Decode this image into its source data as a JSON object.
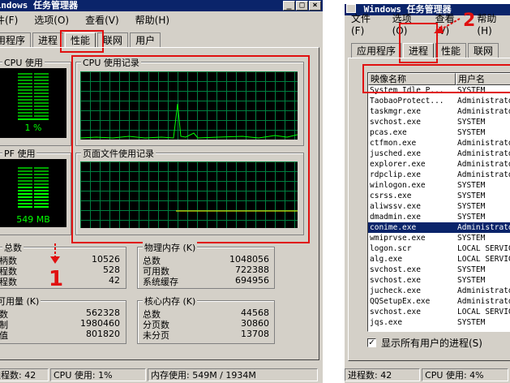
{
  "left": {
    "title": "Windows 任务管理器",
    "menu": [
      "文件(F)",
      "选项(O)",
      "查看(V)",
      "帮助(H)"
    ],
    "tabs": [
      "应用程序",
      "进程",
      "性能",
      "联网",
      "用户"
    ],
    "cpu_usage_label": "CPU 使用",
    "cpu_usage_value": "1 %",
    "cpu_history_label": "CPU 使用记录",
    "pf_usage_label": "PF 使用",
    "pf_usage_value": "549 MB",
    "pf_history_label": "页面文件使用记录",
    "totals": {
      "title": "总数",
      "rows": [
        {
          "label": "句柄数",
          "value": "10526"
        },
        {
          "label": "线程数",
          "value": "528"
        },
        {
          "label": "进程数",
          "value": "42"
        }
      ]
    },
    "physical_memory": {
      "title": "物理内存 (K)",
      "rows": [
        {
          "label": "总数",
          "value": "1048056"
        },
        {
          "label": "可用数",
          "value": "722388"
        },
        {
          "label": "系统缓存",
          "value": "694956"
        }
      ]
    },
    "commit_charge": {
      "title": "认可用量 (K)",
      "rows": [
        {
          "label": "总数",
          "value": "562328"
        },
        {
          "label": "限制",
          "value": "1980460"
        },
        {
          "label": "峰值",
          "value": "801820"
        }
      ]
    },
    "kernel_memory": {
      "title": "核心内存 (K)",
      "rows": [
        {
          "label": "总数",
          "value": "44568"
        },
        {
          "label": "分页数",
          "value": "30860"
        },
        {
          "label": "未分页",
          "value": "13708"
        }
      ]
    },
    "status": {
      "processes": "进程数: 42",
      "cpu": "CPU 使用: 1%",
      "memory": "内存使用: 549M / 1934M"
    },
    "annotation_number": "1"
  },
  "right": {
    "title": "Windows 任务管理器",
    "menu": [
      "文件(F)",
      "选项(O)",
      "查看(V)",
      "帮助(H)"
    ],
    "tabs": [
      "应用程序",
      "进程",
      "性能",
      "联网"
    ],
    "columns": [
      "映像名称",
      "用户名"
    ],
    "processes": [
      {
        "name": "System Idle P...",
        "user": "SYSTEM"
      },
      {
        "name": "TaobaoProtect...",
        "user": "Administrator"
      },
      {
        "name": "taskmgr.exe",
        "user": "Administrator"
      },
      {
        "name": "svchost.exe",
        "user": "SYSTEM"
      },
      {
        "name": "pcas.exe",
        "user": "SYSTEM"
      },
      {
        "name": "ctfmon.exe",
        "user": "Administrator"
      },
      {
        "name": "jusched.exe",
        "user": "Administrator"
      },
      {
        "name": "explorer.exe",
        "user": "Administrator"
      },
      {
        "name": "rdpclip.exe",
        "user": "Administrator"
      },
      {
        "name": "winlogon.exe",
        "user": "SYSTEM"
      },
      {
        "name": "csrss.exe",
        "user": "SYSTEM"
      },
      {
        "name": "aliwssv.exe",
        "user": "SYSTEM"
      },
      {
        "name": "dmadmin.exe",
        "user": "SYSTEM"
      },
      {
        "name": "conime.exe",
        "user": "Administrator"
      },
      {
        "name": "wmiprvse.exe",
        "user": "SYSTEM"
      },
      {
        "name": "logon.scr",
        "user": "LOCAL SERVICE"
      },
      {
        "name": "alg.exe",
        "user": "LOCAL SERVICE"
      },
      {
        "name": "svchost.exe",
        "user": "SYSTEM"
      },
      {
        "name": "svchost.exe",
        "user": "SYSTEM"
      },
      {
        "name": "jucheck.exe",
        "user": "Administrator"
      },
      {
        "name": "QQSetupEx.exe",
        "user": "Administrator"
      },
      {
        "name": "svchost.exe",
        "user": "LOCAL SERVICE"
      },
      {
        "name": "jqs.exe",
        "user": "SYSTEM"
      }
    ],
    "show_all_users_label": "显示所有用户的进程(S)",
    "show_all_users_checked": true,
    "status": {
      "processes": "进程数: 42",
      "cpu": "CPU 使用: 4%"
    },
    "annotation_number": "2"
  }
}
